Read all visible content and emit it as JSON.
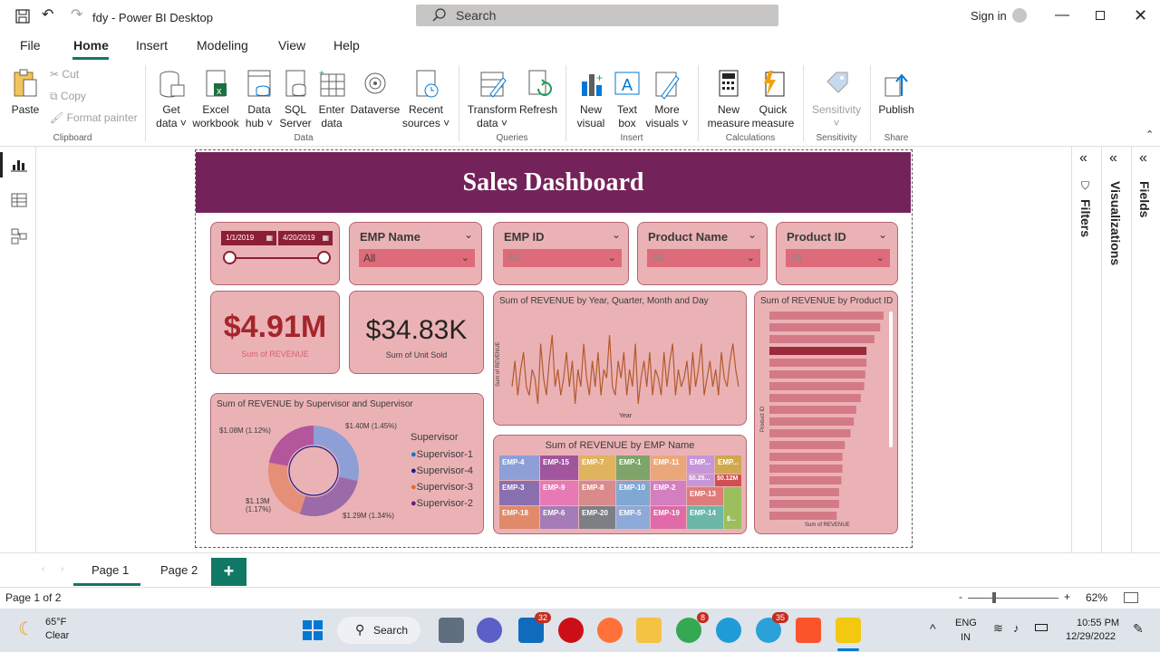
{
  "window": {
    "title": "fdy - Power BI Desktop",
    "search_placeholder": "Search",
    "sign_in": "Sign in"
  },
  "menu": [
    "File",
    "Home",
    "Insert",
    "Modeling",
    "View",
    "Help"
  ],
  "ribbon": {
    "clipboard": {
      "paste": "Paste",
      "cut": "Cut",
      "copy": "Copy",
      "format_painter": "Format painter",
      "group": "Clipboard"
    },
    "data": {
      "get_data": [
        "Get",
        "data ˅"
      ],
      "excel": [
        "Excel",
        "workbook"
      ],
      "data_hub": [
        "Data",
        "hub ˅"
      ],
      "sql": [
        "SQL",
        "Server"
      ],
      "enter": [
        "Enter",
        "data"
      ],
      "dataverse": "Dataverse",
      "recent": [
        "Recent",
        "sources ˅"
      ],
      "group": "Data"
    },
    "queries": {
      "transform": [
        "Transform",
        "data ˅"
      ],
      "refresh": "Refresh",
      "group": "Queries"
    },
    "insert": {
      "new_visual": [
        "New",
        "visual"
      ],
      "text_box": [
        "Text",
        "box"
      ],
      "more_visuals": [
        "More",
        "visuals ˅"
      ],
      "group": "Insert"
    },
    "calculations": {
      "new_measure": [
        "New",
        "measure"
      ],
      "quick_measure": [
        "Quick",
        "measure"
      ],
      "group": "Calculations"
    },
    "sensitivity": {
      "label": "Sensitivity",
      "group": "Sensitivity"
    },
    "share": {
      "publish": "Publish",
      "group": "Share"
    }
  },
  "dashboard": {
    "title": "Sales Dashboard",
    "date_slicer": {
      "from": "1/1/2019",
      "to": "4/20/2019"
    },
    "slicers": [
      {
        "label": "EMP Name",
        "value": "All"
      },
      {
        "label": "EMP ID",
        "value": "All"
      },
      {
        "label": "Product Name",
        "value": "All"
      },
      {
        "label": "Product ID",
        "value": "All"
      }
    ],
    "kpi_revenue": {
      "value": "$4.91M",
      "label": "Sum of REVENUE"
    },
    "kpi_units": {
      "value": "$34.83K",
      "label": "Sum of Unit Sold"
    },
    "line_chart": {
      "title": "Sum of REVENUE by Year, Quarter, Month and Day",
      "xlabel": "Year",
      "ylabel": "Sum of REVENUE"
    },
    "bar_chart": {
      "title": "Sum of REVENUE by Product ID",
      "xlabel": "Sum of REVENUE",
      "ylabel": "Product ID"
    },
    "donut": {
      "title": "Sum of REVENUE by Supervisor and Supervisor",
      "legend_title": "Supervisor",
      "labels": {
        "s1": "$1.40M (1.45%)",
        "s2": "$1.08M (1.12%)",
        "s3": "$1.13M\n(1.17%)",
        "s4": "$1.29M (1.34%)"
      },
      "legend": [
        "Supervisor-1",
        "Supervisor-4",
        "Supervisor-3",
        "Supervisor-2"
      ]
    },
    "treemap": {
      "title": "Sum of REVENUE by EMP Name",
      "tiles": [
        "EMP-4",
        "EMP-15",
        "EMP-7",
        "EMP-1",
        "EMP-11",
        "EMP...",
        "EMP...",
        "EMP-3",
        "EMP-9",
        "EMP-8",
        "EMP-10",
        "EMP-2",
        "EMP-13",
        "EMP-18",
        "EMP-6",
        "EMP-20",
        "EMP-5",
        "EMP-19",
        "EMP-14",
        "$0.25...",
        "$0.12M",
        "$..."
      ]
    }
  },
  "chart_data": [
    {
      "type": "line",
      "title": "Sum of REVENUE by Year, Quarter, Month and Day",
      "xlabel": "Year",
      "ylabel": "Sum of REVENUE",
      "x": [
        1,
        2,
        3,
        4,
        5,
        6,
        7,
        8,
        9,
        10,
        11,
        12,
        13,
        14,
        15,
        16,
        17,
        18,
        19,
        20,
        21,
        22,
        23,
        24,
        25,
        26,
        27,
        28,
        29,
        30,
        31,
        32,
        33,
        34,
        35,
        36,
        37,
        38,
        39,
        40,
        41,
        42,
        43,
        44,
        45,
        46,
        47,
        48,
        49,
        50,
        51,
        52,
        53,
        54,
        55,
        56,
        57,
        58,
        59,
        60,
        61,
        62,
        63,
        64,
        65,
        66,
        67,
        68,
        69,
        70,
        71,
        72,
        73,
        74,
        75,
        76,
        77,
        78,
        79,
        80
      ],
      "values": [
        3,
        6,
        2,
        5,
        7,
        3,
        2,
        5,
        4,
        1,
        8,
        4,
        2,
        6,
        9,
        3,
        5,
        2,
        4,
        7,
        3,
        6,
        1,
        5,
        3,
        8,
        4,
        2,
        6,
        3,
        7,
        2,
        5,
        4,
        9,
        3,
        2,
        6,
        4,
        7,
        2,
        5,
        3,
        8,
        1,
        4,
        6,
        3,
        7,
        2,
        5,
        4,
        2,
        7,
        3,
        6,
        8,
        2,
        5,
        3,
        4,
        6,
        2,
        7,
        3,
        5,
        8,
        2,
        4,
        6,
        3,
        5,
        2,
        7,
        4,
        3,
        6,
        8,
        5,
        3
      ]
    },
    {
      "type": "bar",
      "title": "Sum of REVENUE by Product ID",
      "xlabel": "Sum of REVENUE",
      "ylabel": "Product ID",
      "values": [
        100,
        97,
        92,
        85,
        85,
        84,
        83,
        80,
        76,
        74,
        71,
        66,
        64,
        64,
        63,
        61,
        61,
        59
      ]
    },
    {
      "type": "pie",
      "title": "Sum of REVENUE by Supervisor and Supervisor",
      "categories": [
        "Supervisor-1",
        "Supervisor-2",
        "Supervisor-3",
        "Supervisor-4"
      ],
      "values": [
        1.4,
        1.29,
        1.13,
        1.08
      ]
    }
  ],
  "right_panes": [
    "Filters",
    "Visualizations",
    "Fields"
  ],
  "pages": [
    "Page 1",
    "Page 2"
  ],
  "status": {
    "page_info": "Page 1 of 2",
    "zoom": "62%"
  },
  "taskbar": {
    "weather_temp": "65°F",
    "weather_desc": "Clear",
    "search": "Search",
    "mail_badge": "32",
    "chrome_badge": "8",
    "tg_badge": "35",
    "lang1": "ENG",
    "lang2": "IN",
    "time": "10:55 PM",
    "date": "12/29/2022"
  }
}
